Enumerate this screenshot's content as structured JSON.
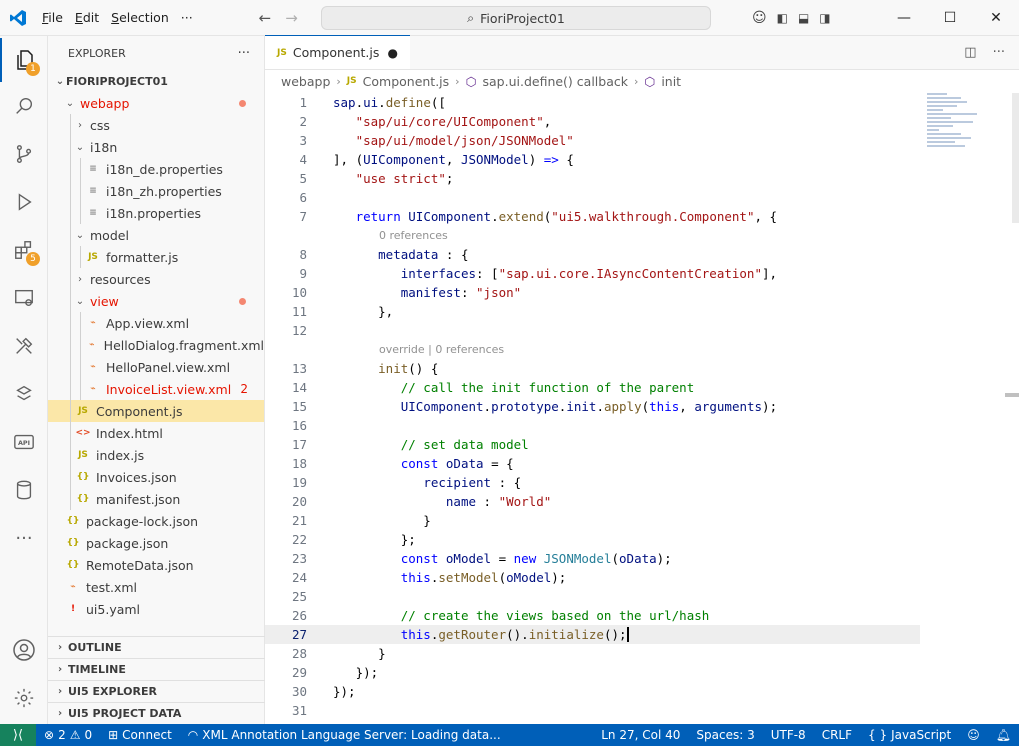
{
  "titlebar": {
    "menu": [
      "File",
      "Edit",
      "Selection"
    ],
    "more": "···",
    "search_text": "FioriProject01"
  },
  "sidebar": {
    "title": "EXPLORER",
    "more": "···",
    "project": "FIORIPROJECT01",
    "tree": [
      {
        "label": "webapp",
        "indent": 1,
        "type": "folder",
        "open": true,
        "err": true,
        "dot": true
      },
      {
        "label": "css",
        "indent": 2,
        "type": "folder",
        "open": false
      },
      {
        "label": "i18n",
        "indent": 2,
        "type": "folder",
        "open": true
      },
      {
        "label": "i18n_de.properties",
        "indent": 3,
        "type": "list"
      },
      {
        "label": "i18n_zh.properties",
        "indent": 3,
        "type": "list"
      },
      {
        "label": "i18n.properties",
        "indent": 3,
        "type": "list"
      },
      {
        "label": "model",
        "indent": 2,
        "type": "folder",
        "open": true
      },
      {
        "label": "formatter.js",
        "indent": 3,
        "type": "js"
      },
      {
        "label": "resources",
        "indent": 2,
        "type": "folder",
        "open": false
      },
      {
        "label": "view",
        "indent": 2,
        "type": "folder",
        "open": true,
        "err": true,
        "dot": true
      },
      {
        "label": "App.view.xml",
        "indent": 3,
        "type": "xml"
      },
      {
        "label": "HelloDialog.fragment.xml",
        "indent": 3,
        "type": "xml"
      },
      {
        "label": "HelloPanel.view.xml",
        "indent": 3,
        "type": "xml"
      },
      {
        "label": "InvoiceList.view.xml",
        "indent": 3,
        "type": "xml",
        "err": true,
        "count": "2"
      },
      {
        "label": "Component.js",
        "indent": 2,
        "type": "js",
        "selected": true
      },
      {
        "label": "Index.html",
        "indent": 2,
        "type": "html"
      },
      {
        "label": "index.js",
        "indent": 2,
        "type": "js"
      },
      {
        "label": "Invoices.json",
        "indent": 2,
        "type": "json"
      },
      {
        "label": "manifest.json",
        "indent": 2,
        "type": "json"
      },
      {
        "label": "package-lock.json",
        "indent": 1,
        "type": "json"
      },
      {
        "label": "package.json",
        "indent": 1,
        "type": "json"
      },
      {
        "label": "RemoteData.json",
        "indent": 1,
        "type": "json"
      },
      {
        "label": "test.xml",
        "indent": 1,
        "type": "xml"
      },
      {
        "label": "ui5.yaml",
        "indent": 1,
        "type": "yaml"
      }
    ],
    "sections": [
      "OUTLINE",
      "TIMELINE",
      "UI5 EXPLORER",
      "UI5 PROJECT DATA"
    ]
  },
  "editor": {
    "tab": {
      "label": "Component.js",
      "modified": "●"
    },
    "breadcrumb": [
      "webapp",
      "Component.js",
      "sap.ui.define() callback",
      "init"
    ],
    "lens": {
      "refs0": "0 references",
      "override": "override | 0 references"
    }
  },
  "status": {
    "problems": "2",
    "warnings": "0",
    "connect": "Connect",
    "xml_server": "XML Annotation Language Server: Loading data...",
    "position": "Ln 27, Col 40",
    "spaces": "Spaces: 3",
    "encoding": "UTF-8",
    "eol": "CRLF",
    "language": "JavaScript"
  },
  "badges": {
    "explorer": "1",
    "extensions": "5"
  }
}
